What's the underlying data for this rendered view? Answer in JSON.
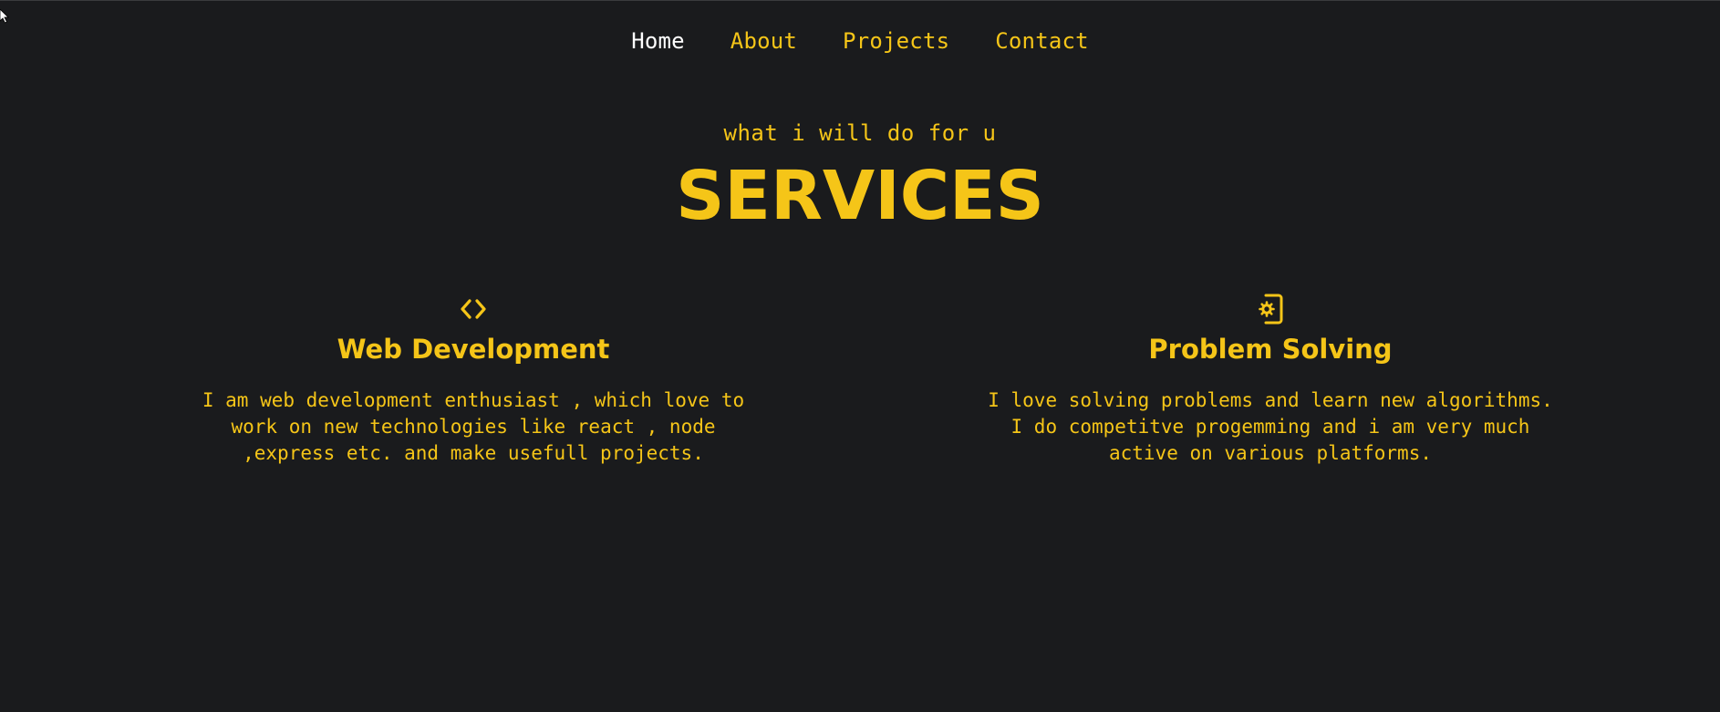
{
  "nav": {
    "items": [
      {
        "label": "Home",
        "active": true
      },
      {
        "label": "About",
        "active": false
      },
      {
        "label": "Projects",
        "active": false
      },
      {
        "label": "Contact",
        "active": false
      }
    ]
  },
  "hero": {
    "subtitle": "what i will do for u",
    "title": "SERVICES"
  },
  "services": [
    {
      "icon": "code-icon",
      "title": "Web Development",
      "description": "I am web development enthusiast , which love to work on new technologies like react , node ,express etc. and make usefull projects."
    },
    {
      "icon": "mobile-gear-icon",
      "title": "Problem Solving",
      "description": "I love solving problems and learn new algorithms. I do competitve progemming and i am very much active on various platforms."
    }
  ],
  "colors": {
    "background": "#1a1b1d",
    "accent": "#f5c518",
    "active_nav": "#ffffff"
  }
}
